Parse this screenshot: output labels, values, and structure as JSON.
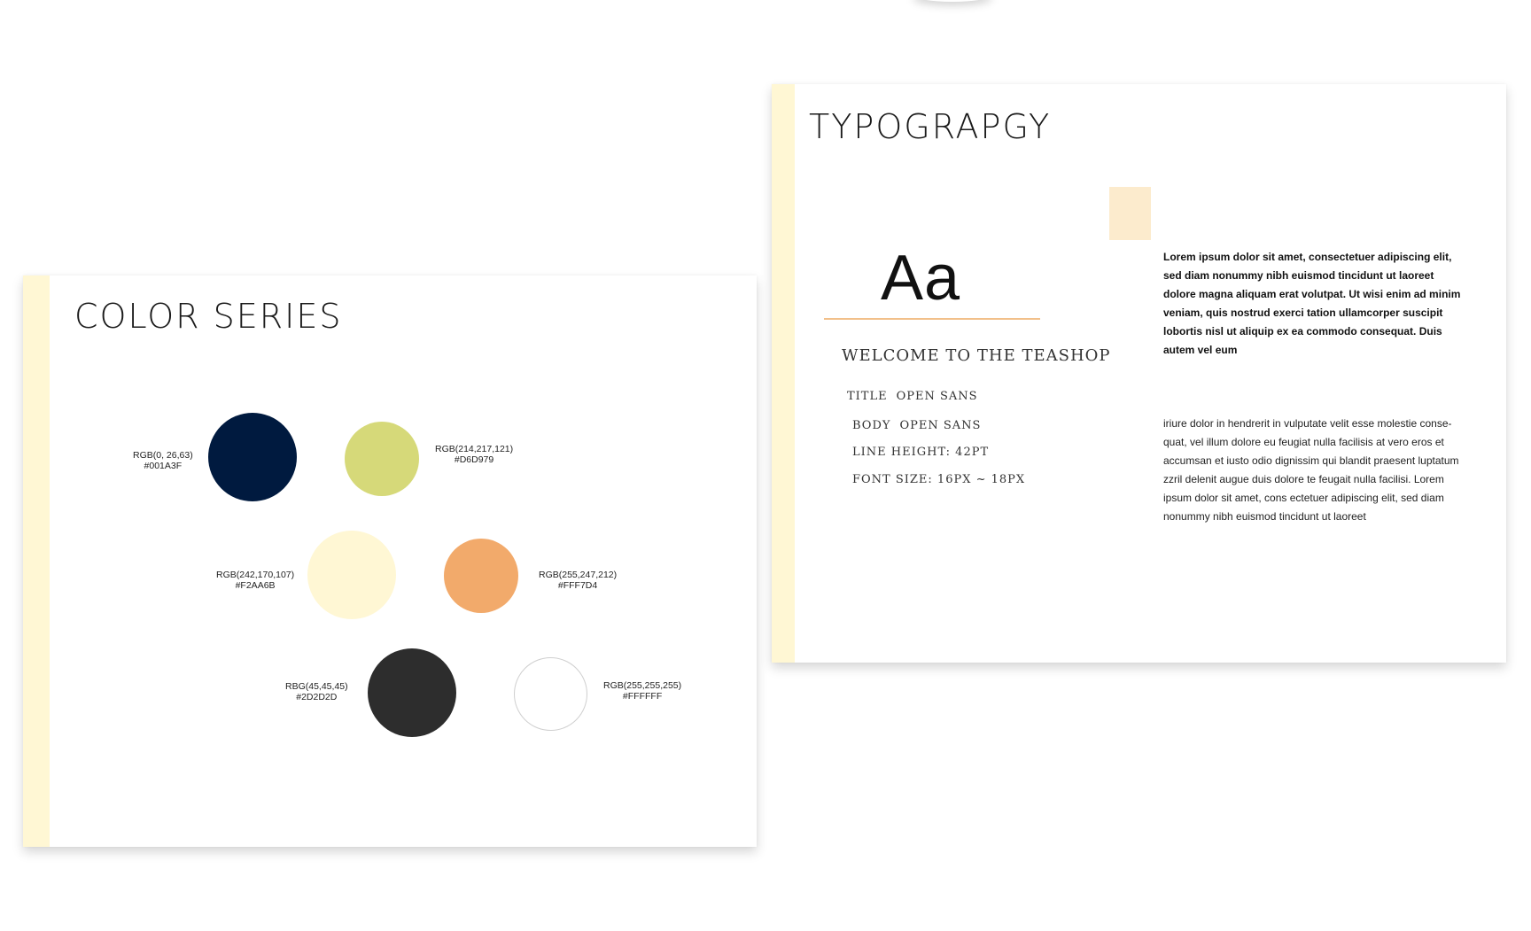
{
  "color_card": {
    "title": "COLOR SERIES",
    "swatches": [
      {
        "rgb": "RGB(0, 26,63)",
        "hex": "#001A3F",
        "color": "#001A3F"
      },
      {
        "rgb": "RGB(214,217,121)",
        "hex": "#D6D979",
        "color": "#D6D979"
      },
      {
        "rgb": "RGB(242,170,107)",
        "hex": "#F2AA6B",
        "color": "#FFF7D4"
      },
      {
        "rgb": "RGB(255,247,212)",
        "hex": "#FFF7D4",
        "color": "#F2AA6B"
      },
      {
        "rgb": "RBG(45,45,45)",
        "hex": "#2D2D2D",
        "color": "#2D2D2D"
      },
      {
        "rgb": "RGB(255,255,255)",
        "hex": "#FFFFFF",
        "color": "#FFFFFF"
      }
    ]
  },
  "type_card": {
    "title": "TYPOGRAPGY",
    "specimen": "Aa",
    "subheading": "WELCOME TO THE TEASHOP",
    "specs": [
      {
        "label": "TITLE",
        "value": "OPEN SANS"
      },
      {
        "label": "BODY",
        "value": "OPEN SANS"
      },
      {
        "label": "LINE HEIGHT: 42PT",
        "value": ""
      },
      {
        "label": "FONT SIZE: 16PX ~ 18PX",
        "value": ""
      }
    ],
    "bold_paragraph": "Lorem ipsum dolor sit amet, consectetuer adipiscing elit, sed diam nonummy nibh euismod tincidunt ut laoreet dolore magna aliquam erat volutpat. Ut wisi enim ad minim veniam, quis nostrud exerci tation ullamcorper suscipit lobortis nisl ut aliquip ex ea commodo consequat. Duis autem vel eum",
    "body_paragraph": "iriure dolor in hendrerit in vulputate velit esse molestie conse-quat, vel illum dolore eu feugiat nulla facilisis at vero eros et accumsan et iusto odio dignissim qui blandit praesent luptatum zzril delenit augue duis dolore te feugait nulla facilisi. Lorem ipsum dolor sit amet, cons ectetuer adipiscing elit, sed diam nonummy nibh euismod tincidunt ut laoreet"
  },
  "colors": {
    "stripe": "#FFF7D4",
    "accent_square": "#FCEBCD",
    "underline": "#F2C08A"
  }
}
